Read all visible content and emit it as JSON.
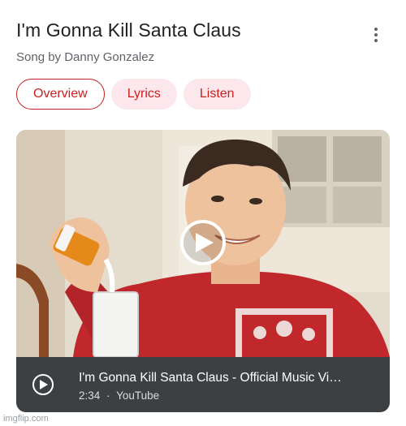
{
  "header": {
    "title": "I'm Gonna Kill Santa Claus",
    "subtitle": "Song by Danny Gonzalez",
    "more_icon": "more-vert-icon"
  },
  "tabs": [
    {
      "label": "Overview",
      "active": true
    },
    {
      "label": "Lyrics",
      "active": false
    },
    {
      "label": "Listen",
      "active": false
    }
  ],
  "video": {
    "title": "I'm Gonna Kill Santa Claus - Official Music Vi…",
    "duration": "2:34",
    "separator": "·",
    "source": "YouTube",
    "play_icon": "play-circle-icon"
  },
  "watermark": "imgflip.com",
  "colors": {
    "accent": "#c5221f",
    "chip_bg": "#fce8ec",
    "video_bar": "#3c4043",
    "sweater": "#c0282c"
  }
}
